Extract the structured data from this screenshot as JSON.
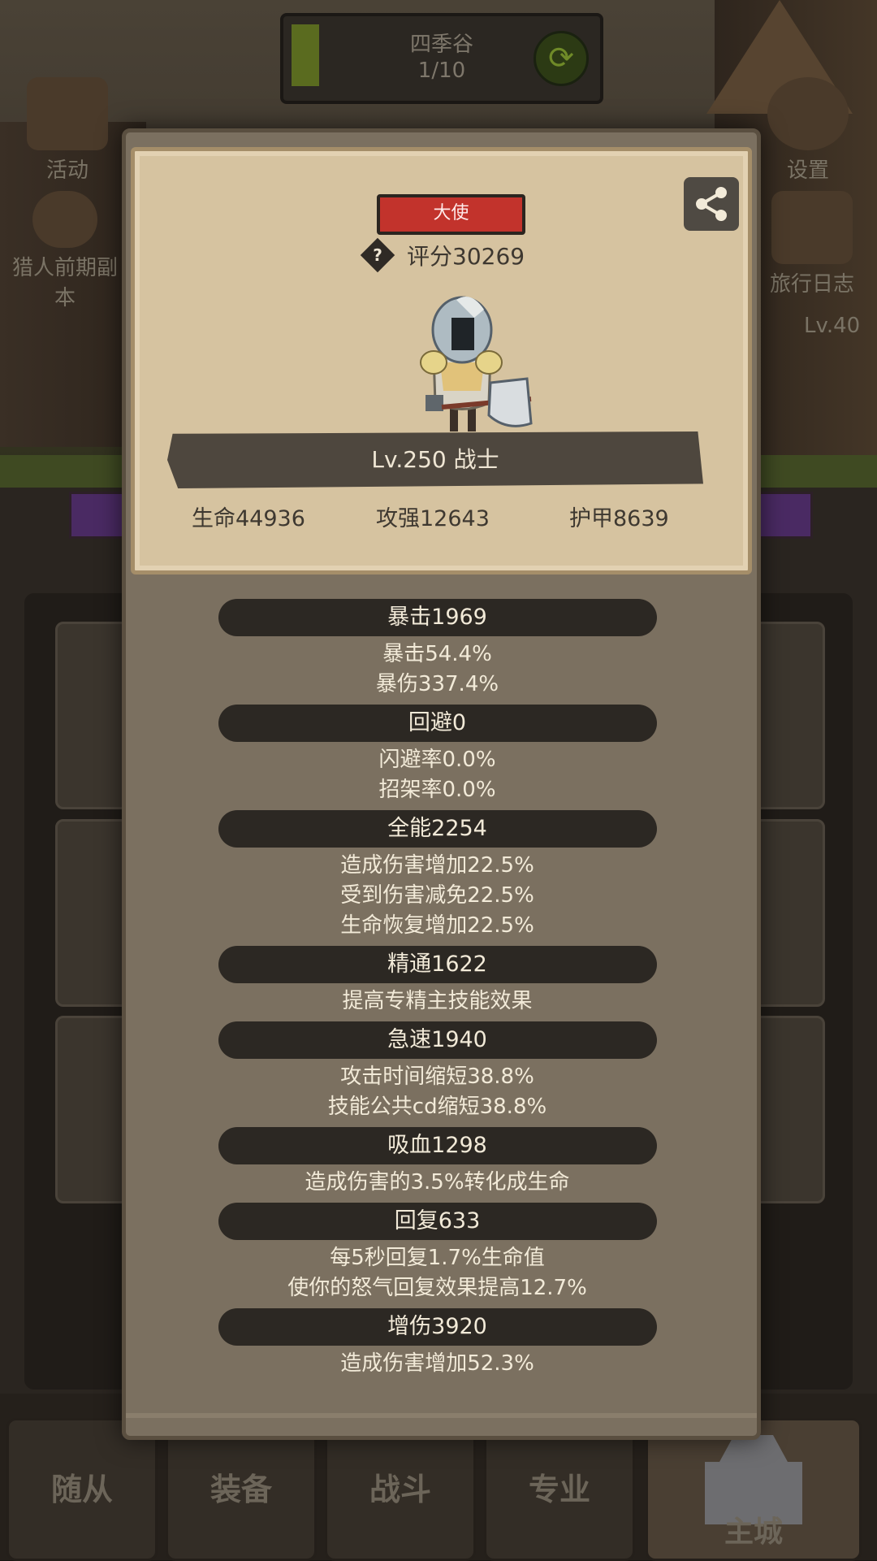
{
  "background": {
    "stage": {
      "name": "四季谷",
      "count": "1/10"
    },
    "left_buttons": [
      {
        "label": "活动"
      },
      {
        "label": "猎人前期副本"
      }
    ],
    "right_buttons": [
      {
        "label": "设置"
      },
      {
        "label": "旅行日志"
      }
    ],
    "level_hint": "Lv.40",
    "nav_tabs": [
      "随从",
      "装备",
      "战斗",
      "专业",
      "主城"
    ]
  },
  "hero": {
    "rank": "大使",
    "score": "评分30269",
    "level_class": "Lv.250 战士",
    "base_stats": [
      "生命44936",
      "攻强12643",
      "护甲8639"
    ]
  },
  "stat_groups": [
    {
      "header": "暴击1969",
      "lines": [
        "暴击54.4%",
        "暴伤337.4%"
      ]
    },
    {
      "header": "回避0",
      "lines": [
        "闪避率0.0%",
        "招架率0.0%"
      ]
    },
    {
      "header": "全能2254",
      "lines": [
        "造成伤害增加22.5%",
        "受到伤害减免22.5%",
        "生命恢复增加22.5%"
      ]
    },
    {
      "header": "精通1622",
      "lines": [
        "提高专精主技能效果"
      ]
    },
    {
      "header": "急速1940",
      "lines": [
        "攻击时间缩短38.8%",
        "技能公共cd缩短38.8%"
      ]
    },
    {
      "header": "吸血1298",
      "lines": [
        "造成伤害的3.5%转化成生命"
      ]
    },
    {
      "header": "回复633",
      "lines": [
        "每5秒回复1.7%生命值",
        "使你的怒气回复效果提高12.7%"
      ]
    },
    {
      "header": "增伤3920",
      "lines": [
        "造成伤害增加52.3%"
      ]
    }
  ],
  "colors": {
    "rank_badge": "#c2332c",
    "parchment": "#d6c3a0",
    "modal": "#7b7060",
    "pill": "#2c2823"
  }
}
